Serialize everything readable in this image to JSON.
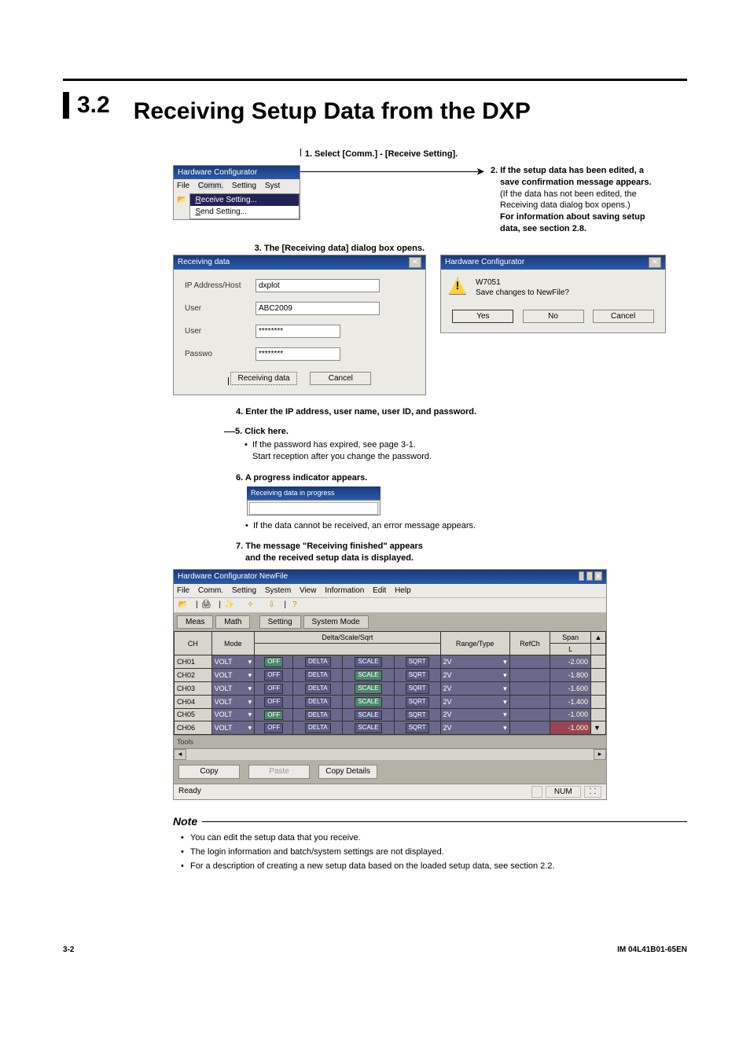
{
  "heading": {
    "num": "3.2",
    "text": "Receiving Setup Data from the DXP"
  },
  "step1": "1. Select [Comm.] - [Receive Setting].",
  "step2": {
    "line1": "2. If the setup data has been edited, a",
    "line2": "save confirmation message appears.",
    "line3": "(If the data has not been edited, the",
    "line4": "Receiving data dialog box opens.)",
    "line5": "For information about saving setup",
    "line6": "data, see section 2.8."
  },
  "step3": "3. The [Receiving data] dialog box opens.",
  "step4": "4. Enter the IP address, user name, user ID, and password.",
  "step5": {
    "head": "5. Click here.",
    "b1": "If the password has expired, see page 3-1.",
    "b1b": "Start reception after you change the password."
  },
  "step6": {
    "head": "6. A progress indicator appears.",
    "b1": "If the data cannot be received, an error message appears."
  },
  "step7": {
    "line1": "7. The message \"Receiving finished\" appears",
    "line2": "and the received setup data is displayed."
  },
  "shot_menu": {
    "title": "Hardware Configurator",
    "m_file": "File",
    "m_comm": "Comm.",
    "m_setting": "Setting",
    "m_syst": "Syst",
    "dd1": "Receive Setting...",
    "dd2": "Send Setting..."
  },
  "recv_dialog": {
    "title": "Receiving data",
    "ip_label": "IP Address/Host",
    "ip_val": "dxplot",
    "user_label": "User",
    "user_val": "ABC2009",
    "user2_label": "User",
    "user2_val": "********",
    "pass_label": "Passwo",
    "pass_val": "********",
    "btn_recv": "Receiving data",
    "btn_cancel": "Cancel"
  },
  "confirm_dialog": {
    "title": "Hardware Configurator",
    "code": "W7051",
    "msg": "Save changes to NewFile?",
    "yes": "Yes",
    "no": "No",
    "cancel": "Cancel"
  },
  "progress": {
    "title": "Receiving data in progress"
  },
  "main_shot": {
    "title": "Hardware Configurator NewFile",
    "menu": {
      "file": "File",
      "comm": "Comm.",
      "setting": "Setting",
      "system": "System",
      "view": "View",
      "info": "Information",
      "edit": "Edit",
      "help": "Help"
    },
    "tabs": {
      "meas": "Meas",
      "math": "Math",
      "setting": "Setting",
      "sysmode": "System Mode"
    },
    "headers": {
      "ch": "CH",
      "mode": "Mode",
      "dss": "Delta/Scale/Sqrt",
      "range": "Range/Type",
      "refch": "RefCh",
      "span": "Span",
      "L": "L"
    },
    "rows": [
      {
        "ch": "CH01",
        "mode": "VOLT",
        "off": "OFF",
        "d": "DELTA",
        "s": "SCALE",
        "q": "SQRT",
        "r": "2V",
        "span": "-2.000",
        "hl": "d"
      },
      {
        "ch": "CH02",
        "mode": "VOLT",
        "off": "OFF",
        "d": "DELTA",
        "s": "SCALE",
        "q": "SQRT",
        "r": "2V",
        "span": "-1.800",
        "hl": "s"
      },
      {
        "ch": "CH03",
        "mode": "VOLT",
        "off": "OFF",
        "d": "DELTA",
        "s": "SCALE",
        "q": "SQRT",
        "r": "2V",
        "span": "-1.600",
        "hl": "s"
      },
      {
        "ch": "CH04",
        "mode": "VOLT",
        "off": "OFF",
        "d": "DELTA",
        "s": "SCALE",
        "q": "SQRT",
        "r": "2V",
        "span": "-1.400",
        "hl": "s"
      },
      {
        "ch": "CH05",
        "mode": "VOLT",
        "off": "OFF",
        "d": "DELTA",
        "s": "SCALE",
        "q": "SQRT",
        "r": "2V",
        "span": "-1.000",
        "hl": "d"
      },
      {
        "ch": "CH06",
        "mode": "VOLT",
        "off": "OFF",
        "d": "DELTA",
        "s": "SCALE",
        "q": "SQRT",
        "r": "2V",
        "span": "-1.000",
        "hl": ""
      }
    ],
    "tools": "Tools",
    "copy": "Copy",
    "paste": "Paste",
    "copyd": "Copy Details",
    "ready": "Ready",
    "num": "NUM"
  },
  "note": {
    "head": "Note",
    "b1": "You can edit the setup data that you receive.",
    "b2": "The login information and batch/system settings are not displayed.",
    "b3": "For a description of creating a new setup data based on the loaded setup data, see section 2.2."
  },
  "footer": {
    "left": "3-2",
    "right": "IM 04L41B01-65EN"
  }
}
